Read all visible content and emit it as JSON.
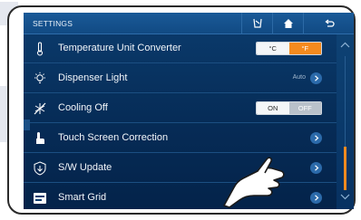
{
  "header": {
    "title": "SETTINGS",
    "buttons": [
      {
        "name": "filter-icon"
      },
      {
        "name": "home-icon"
      },
      {
        "name": "back-icon"
      }
    ]
  },
  "settings": [
    {
      "label": "Temperature Unit Converter",
      "icon": "thermometer-icon",
      "control": "segmented",
      "options": [
        "°C",
        "°F"
      ],
      "selected": "°F"
    },
    {
      "label": "Dispenser Light",
      "icon": "light-bulb-icon",
      "control": "link",
      "value": "Auto"
    },
    {
      "label": "Cooling Off",
      "icon": "snowflake-off-icon",
      "control": "segmented",
      "options": [
        "ON",
        "OFF"
      ],
      "selected": "OFF"
    },
    {
      "label": "Touch Screen Correction",
      "icon": "touch-icon",
      "control": "link"
    },
    {
      "label": "S/W Update",
      "icon": "shield-update-icon",
      "control": "link"
    },
    {
      "label": "Smart Grid",
      "icon": "smart-grid-icon",
      "control": "link"
    }
  ],
  "colors": {
    "accent": "#f48a1e",
    "screen_bg": "#062c57",
    "header_bg": "#1a5a98"
  }
}
